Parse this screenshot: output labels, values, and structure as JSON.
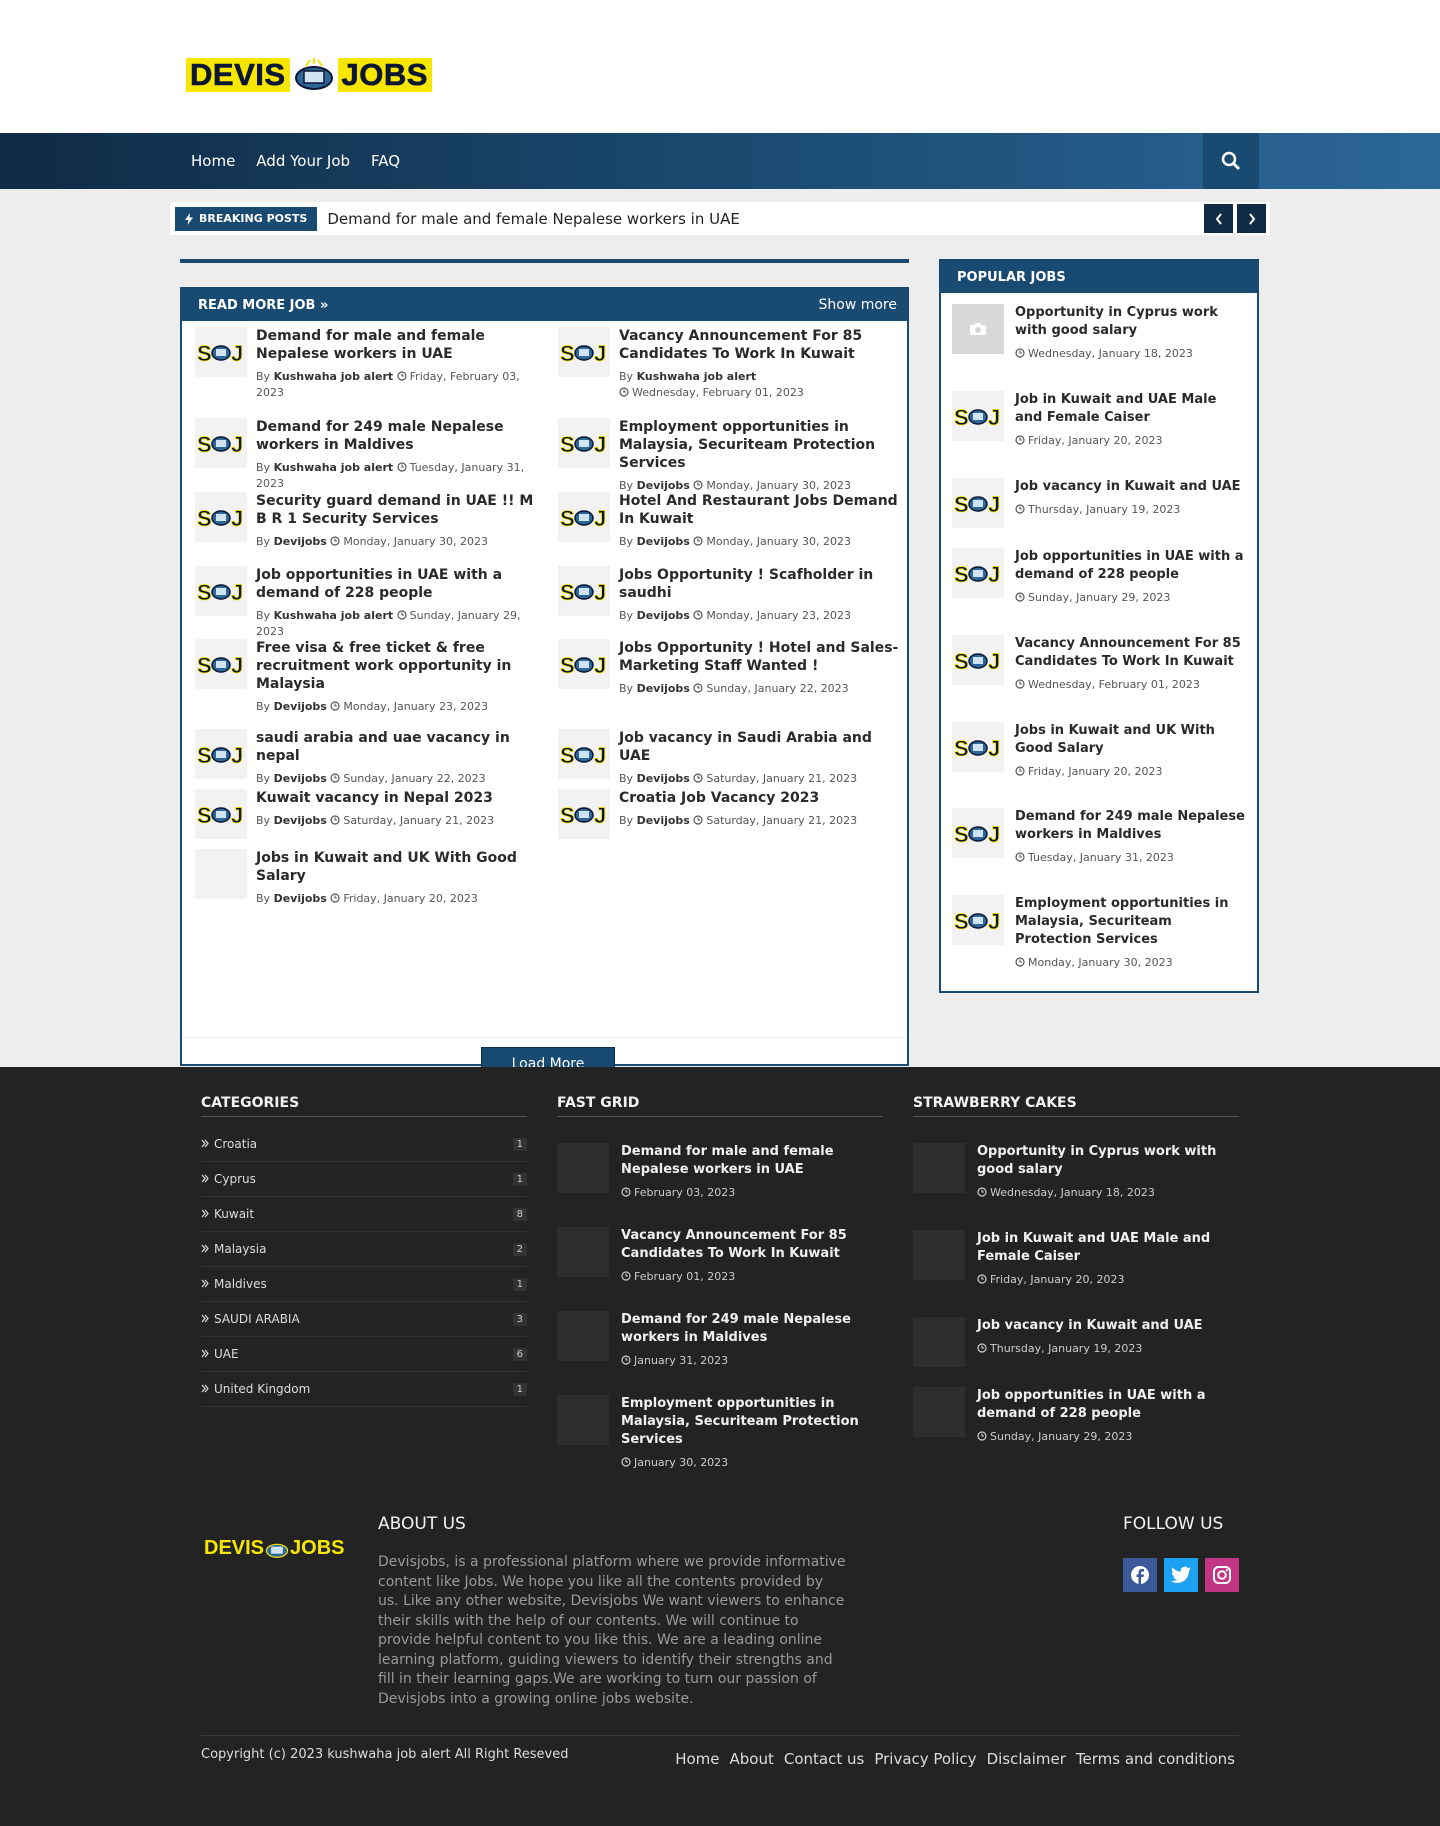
{
  "site": {
    "logo_left": "DEVIS",
    "logo_right": "JOBS"
  },
  "nav": {
    "items": [
      "Home",
      "Add Your Job",
      "FAQ"
    ]
  },
  "breaking": {
    "label": "BREAKING POSTS",
    "title": "Demand for male and female Nepalese workers in UAE"
  },
  "main": {
    "heading": "READ MORE JOB »",
    "show_more": "Show more",
    "load_more": "Load More",
    "by": "By",
    "posts": [
      {
        "title": "Demand for male and female Nepalese workers in UAE",
        "author": "Kushwaha job alert",
        "date": "Friday, February 03, 2023"
      },
      {
        "title": "Vacancy Announcement For 85 Candidates To Work In Kuwait",
        "author": "Kushwaha job alert",
        "date": "Wednesday, February 01, 2023"
      },
      {
        "title": "Demand for 249 male Nepalese workers in Maldives",
        "author": "Kushwaha job alert",
        "date": "Tuesday, January 31, 2023"
      },
      {
        "title": "Employment opportunities in Malaysia, Securiteam Protection Services",
        "author": "Devijobs",
        "date": "Monday, January 30, 2023"
      },
      {
        "title": "Security guard demand in UAE !! M B R 1 Security Services",
        "author": "Devijobs",
        "date": "Monday, January 30, 2023"
      },
      {
        "title": "Hotel And Restaurant Jobs Demand In Kuwait",
        "author": "Devijobs",
        "date": "Monday, January 30, 2023"
      },
      {
        "title": "Job opportunities in UAE with a demand of 228 people",
        "author": "Kushwaha job alert",
        "date": "Sunday, January 29, 2023"
      },
      {
        "title": "Jobs Opportunity ! Scafholder in saudhi",
        "author": "Devijobs",
        "date": "Monday, January 23, 2023"
      },
      {
        "title": "Free visa & free ticket & free recruitment work opportunity in Malaysia",
        "author": "Devijobs",
        "date": "Monday, January 23, 2023"
      },
      {
        "title": "Jobs Opportunity ! Hotel and Sales-Marketing Staff Wanted !",
        "author": "Devijobs",
        "date": "Sunday, January 22, 2023"
      },
      {
        "title": "saudi arabia and uae vacancy in nepal",
        "author": "Devijobs",
        "date": "Sunday, January 22, 2023"
      },
      {
        "title": "Job vacancy in Saudi Arabia and UAE",
        "author": "Devijobs",
        "date": "Saturday, January 21, 2023"
      },
      {
        "title": "Kuwait vacancy in Nepal 2023",
        "author": "Devijobs",
        "date": "Saturday, January 21, 2023"
      },
      {
        "title": "Croatia Job Vacancy 2023",
        "author": "Devijobs",
        "date": "Saturday, January 21, 2023"
      },
      {
        "title": "Jobs in Kuwait and UK With Good Salary",
        "author": "Devijobs",
        "date": "Friday, January 20, 2023"
      }
    ]
  },
  "popular": {
    "heading": "POPULAR JOBS",
    "posts": [
      {
        "title": "Opportunity in Cyprus work with good salary",
        "date": "Wednesday, January 18, 2023"
      },
      {
        "title": "Job in Kuwait and UAE Male and Female Caiser",
        "date": "Friday, January 20, 2023"
      },
      {
        "title": "Job vacancy in Kuwait and UAE",
        "date": "Thursday, January 19, 2023"
      },
      {
        "title": "Job opportunities in UAE with a demand of 228 people",
        "date": "Sunday, January 29, 2023"
      },
      {
        "title": "Vacancy Announcement For 85 Candidates To Work In Kuwait",
        "date": "Wednesday, February 01, 2023"
      },
      {
        "title": "Jobs in Kuwait and UK With Good Salary",
        "date": "Friday, January 20, 2023"
      },
      {
        "title": "Demand for 249 male Nepalese workers in Maldives",
        "date": "Tuesday, January 31, 2023"
      },
      {
        "title": "Employment opportunities in Malaysia, Securiteam Protection Services",
        "date": "Monday, January 30, 2023"
      }
    ]
  },
  "footer": {
    "categories": {
      "heading": "CATEGORIES",
      "items": [
        {
          "name": "Croatia",
          "count": "1"
        },
        {
          "name": "Cyprus",
          "count": "1"
        },
        {
          "name": "Kuwait",
          "count": "8"
        },
        {
          "name": "Malaysia",
          "count": "2"
        },
        {
          "name": "Maldives",
          "count": "1"
        },
        {
          "name": "SAUDI ARABIA",
          "count": "3"
        },
        {
          "name": "UAE",
          "count": "6"
        },
        {
          "name": "United Kingdom",
          "count": "1"
        }
      ]
    },
    "fast_grid": {
      "heading": "FAST GRID",
      "posts": [
        {
          "title": "Demand for male and female Nepalese workers in UAE",
          "date": "February 03, 2023"
        },
        {
          "title": "Vacancy Announcement For 85 Candidates To Work In Kuwait",
          "date": "February 01, 2023"
        },
        {
          "title": "Demand for 249 male Nepalese workers in Maldives",
          "date": "January 31, 2023"
        },
        {
          "title": "Employment opportunities in Malaysia, Securiteam Protection Services",
          "date": "January 30, 2023"
        }
      ]
    },
    "strawberry": {
      "heading": "STRAWBERRY CAKES",
      "posts": [
        {
          "title": "Opportunity in Cyprus work with good salary",
          "date": "Wednesday, January 18, 2023"
        },
        {
          "title": "Job in Kuwait and UAE Male and Female Caiser",
          "date": "Friday, January 20, 2023"
        },
        {
          "title": "Job vacancy in Kuwait and UAE",
          "date": "Thursday, January 19, 2023"
        },
        {
          "title": "Job opportunities in UAE with a demand of 228 people",
          "date": "Sunday, January 29, 2023"
        }
      ]
    },
    "about_heading": "ABOUT US",
    "about_text": "Devisjobs, is a professional platform where we provide informative content like Jobs. We hope you like all the contents provided by us. Like any other website, Devisjobs We want viewers to enhance their skills with the help of our contents. We will continue to provide helpful content to you like this. We are a leading online learning platform, guiding viewers to identify their strengths and fill in their learning gaps.We are working to turn our passion of Devisjobs into a growing online jobs website.",
    "follow_heading": "FOLLOW US",
    "copyright": "Copyright (c) 2023 kushwaha job alert All Right Reseved",
    "links": [
      "Home",
      "About",
      "Contact us",
      "Privacy Policy",
      "Disclaimer",
      "Terms and conditions"
    ]
  },
  "colors": {
    "primary": "#184a72",
    "dark": "#0f2b45",
    "footer_bg": "#232323",
    "logo_yellow": "#f6e600",
    "facebook": "#3b5998",
    "twitter": "#1da1f2",
    "instagram": "#c13584"
  },
  "icons": [
    "search-icon",
    "bolt-icon",
    "chevron-left-icon",
    "chevron-right-icon",
    "clock-icon",
    "camera-icon",
    "chevron-bullet-icon",
    "facebook-icon",
    "twitter-icon",
    "instagram-icon"
  ]
}
